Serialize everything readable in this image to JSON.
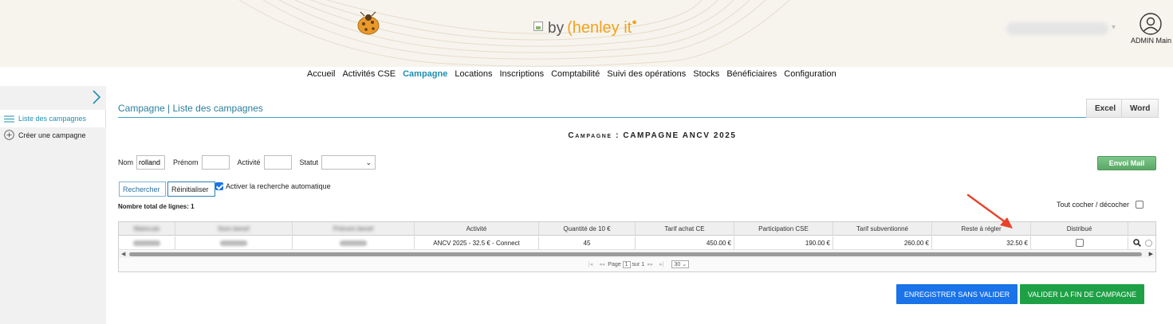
{
  "header": {
    "brand_by": "by",
    "brand_name": "(henley it",
    "user_label": "ADMIN Main"
  },
  "menu": [
    {
      "label": "Accueil",
      "active": false
    },
    {
      "label": "Activités CSE",
      "active": false
    },
    {
      "label": "Campagne",
      "active": true
    },
    {
      "label": "Locations",
      "active": false
    },
    {
      "label": "Inscriptions",
      "active": false
    },
    {
      "label": "Comptabilité",
      "active": false
    },
    {
      "label": "Suivi des opérations",
      "active": false
    },
    {
      "label": "Stocks",
      "active": false
    },
    {
      "label": "Bénéficiaires",
      "active": false
    },
    {
      "label": "Configuration",
      "active": false
    }
  ],
  "sidebar": {
    "items": [
      {
        "label": "Liste des campagnes",
        "icon": "list-icon",
        "active": true
      },
      {
        "label": "Créer une campagne",
        "icon": "plus-circle-icon",
        "active": false
      }
    ]
  },
  "page": {
    "breadcrumb": "Campagne | Liste des campagnes",
    "excel_label": "Excel",
    "word_label": "Word",
    "title": "Campagne : CAMPAGNE ANCV 2025"
  },
  "filters": {
    "nom_label": "Nom",
    "nom_value": "rolland",
    "prenom_label": "Prénom",
    "prenom_value": "",
    "activite_label": "Activité",
    "activite_value": "",
    "statut_label": "Statut",
    "statut_value": "",
    "search_label": "Rechercher",
    "reset_label": "Réinitialiser",
    "auto_search_label": "Activer la recherche automatique",
    "auto_search_checked": true,
    "envoi_mail_label": "Envoi Mail"
  },
  "grid": {
    "total_label": "Nombre total de lignes: 1",
    "check_all_label": "Tout cocher / décocher",
    "columns": [
      "Matricule",
      "Nom benef",
      "Prénom benef",
      "Activité",
      "Quantité de 10 €",
      "Tarif achat CE",
      "Participation CSE",
      "Tarif subventionné",
      "Reste à régler",
      "Distribué",
      ""
    ],
    "rows": [
      {
        "activite": "ANCV 2025 - 32.5 € - Connect",
        "quantite": "45",
        "tarif_achat": "450.00 €",
        "participation": "190.00 €",
        "tarif_subventionne": "260.00 €",
        "reste": "32.50 €",
        "distribue": false
      }
    ],
    "pager": {
      "page_label": "Page",
      "page_value": "1",
      "of_label": "sur 1",
      "page_size": "30"
    }
  },
  "actions": {
    "save_label": "ENREGISTRER SANS VALIDER",
    "validate_label": "VALIDER LA FIN DE CAMPAGNE"
  },
  "colors": {
    "accent": "#1e8fb0",
    "save_blue": "#1a73e8",
    "validate_green": "#1ea146",
    "arrow_red": "#e8412c"
  }
}
